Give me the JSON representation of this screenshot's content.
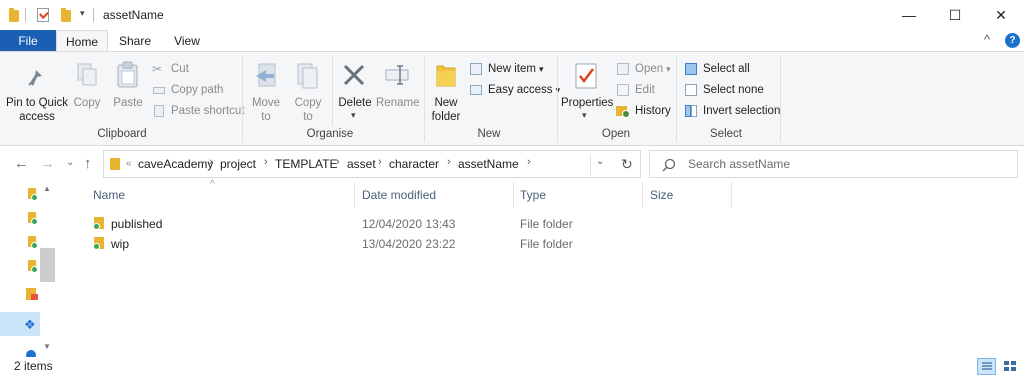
{
  "window": {
    "title": "assetName",
    "controls": {
      "minimize": "—",
      "maximize": "☐",
      "close": "✕"
    }
  },
  "ribbon": {
    "tabs": [
      "File",
      "Home",
      "Share",
      "View"
    ],
    "collapse": "^",
    "help": "?",
    "clipboard": {
      "label": "Clipboard",
      "pin_to_quick_access": [
        "Pin to Quick",
        "access"
      ],
      "copy": "Copy",
      "paste": "Paste",
      "cut": "Cut",
      "copy_path": "Copy path",
      "paste_shortcut": "Paste shortcut"
    },
    "organise": {
      "label": "Organise",
      "move_to": [
        "Move",
        "to"
      ],
      "copy_to": [
        "Copy",
        "to"
      ],
      "delete": "Delete",
      "rename": "Rename"
    },
    "new": {
      "label": "New",
      "new_folder": [
        "New",
        "folder"
      ],
      "new_item": "New item",
      "easy_access": "Easy access"
    },
    "open": {
      "label": "Open",
      "properties": "Properties",
      "open": "Open",
      "edit": "Edit",
      "history": "History"
    },
    "select": {
      "label": "Select",
      "select_all": "Select all",
      "select_none": "Select none",
      "invert_selection": "Invert selection"
    }
  },
  "address": {
    "breadcrumbs": [
      "caveAcademy",
      "project",
      "TEMPLATE",
      "asset",
      "character",
      "assetName"
    ],
    "overflow": "«",
    "search_placeholder": "Search assetName"
  },
  "columns": {
    "name": "Name",
    "date_modified": "Date modified",
    "type": "Type",
    "size": "Size"
  },
  "files": [
    {
      "name": "published",
      "date_modified": "12/04/2020 13:43",
      "type": "File folder",
      "size": ""
    },
    {
      "name": "wip",
      "date_modified": "13/04/2020 23:22",
      "type": "File folder",
      "size": ""
    }
  ],
  "status": {
    "item_count": "2 items"
  },
  "colors": {
    "file_tab": "#1a5fb4",
    "folder": "#e8b533",
    "ribbon_bg": "#f5f6f7",
    "header_text": "#4c607a"
  }
}
